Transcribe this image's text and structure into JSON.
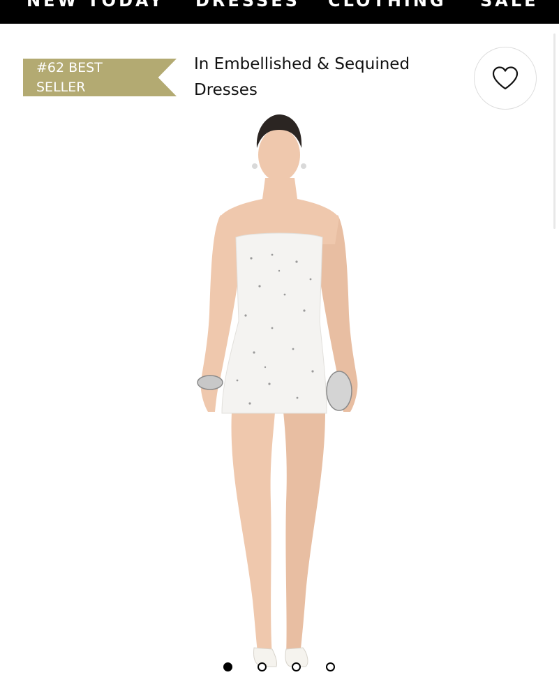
{
  "nav": {
    "items": [
      "NEW TODAY",
      "DRESSES",
      "CLOTHING",
      "SALE"
    ]
  },
  "badge": {
    "text": "#62 BEST SELLER",
    "color": "#b3aa72"
  },
  "product": {
    "title": "In Embellished & Sequined Dresses"
  },
  "wishlist": {
    "icon": "heart-outline-icon"
  },
  "carousel": {
    "total": 4,
    "active": 1
  }
}
